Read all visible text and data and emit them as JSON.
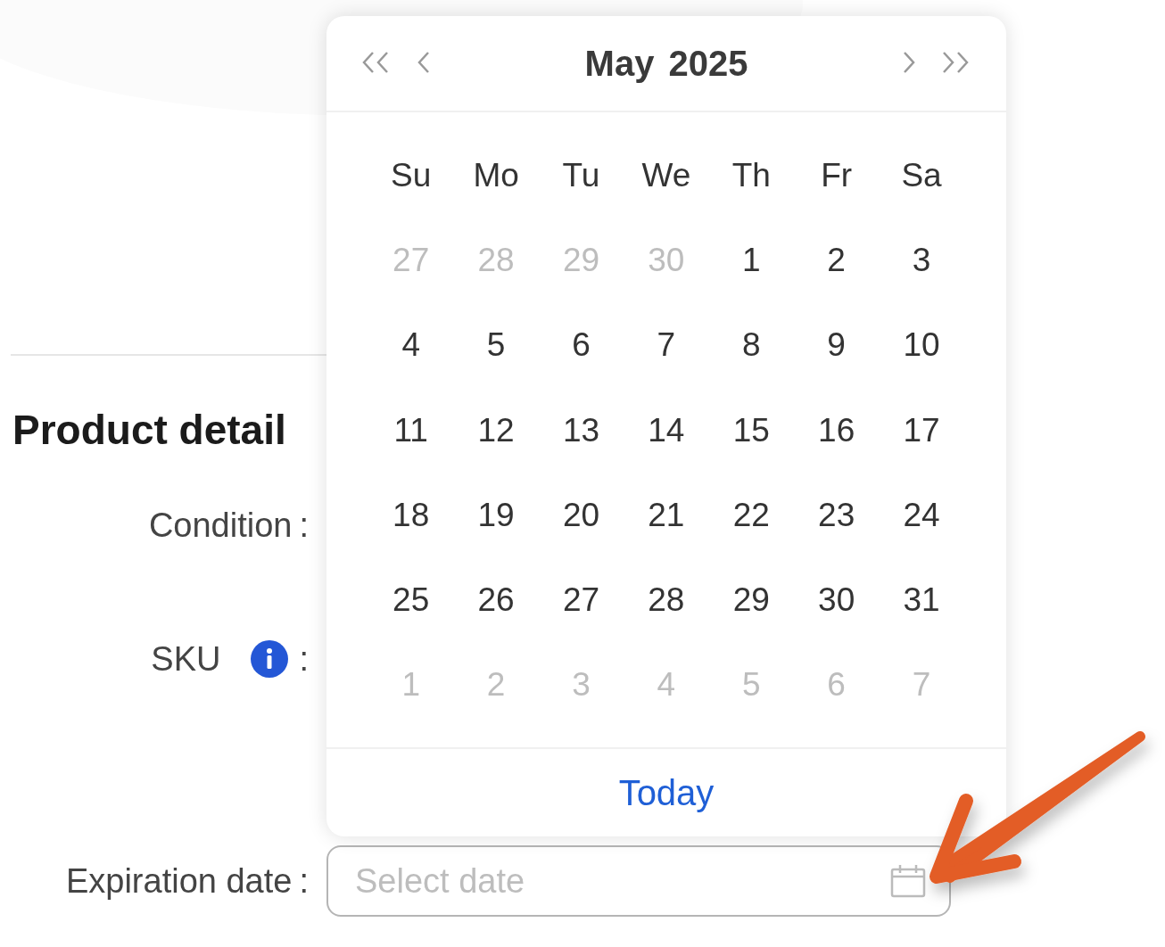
{
  "section": {
    "title": "Product detail"
  },
  "fields": [
    {
      "label": "Condition",
      "separator": ":",
      "info": false
    },
    {
      "label": "SKU",
      "separator": ":",
      "info": true
    },
    {
      "label": "Expiration date",
      "separator": ":",
      "info": false,
      "placeholder": "Select date"
    }
  ],
  "calendar": {
    "month": "May",
    "year": "2025",
    "weekdays": [
      "Su",
      "Mo",
      "Tu",
      "We",
      "Th",
      "Fr",
      "Sa"
    ],
    "weeks": [
      [
        {
          "day": "27",
          "outside": true
        },
        {
          "day": "28",
          "outside": true
        },
        {
          "day": "29",
          "outside": true
        },
        {
          "day": "30",
          "outside": true
        },
        {
          "day": "1",
          "outside": false
        },
        {
          "day": "2",
          "outside": false
        },
        {
          "day": "3",
          "outside": false
        }
      ],
      [
        {
          "day": "4",
          "outside": false
        },
        {
          "day": "5",
          "outside": false
        },
        {
          "day": "6",
          "outside": false
        },
        {
          "day": "7",
          "outside": false
        },
        {
          "day": "8",
          "outside": false
        },
        {
          "day": "9",
          "outside": false
        },
        {
          "day": "10",
          "outside": false
        }
      ],
      [
        {
          "day": "11",
          "outside": false
        },
        {
          "day": "12",
          "outside": false
        },
        {
          "day": "13",
          "outside": false
        },
        {
          "day": "14",
          "outside": false
        },
        {
          "day": "15",
          "outside": false
        },
        {
          "day": "16",
          "outside": false
        },
        {
          "day": "17",
          "outside": false
        }
      ],
      [
        {
          "day": "18",
          "outside": false
        },
        {
          "day": "19",
          "outside": false
        },
        {
          "day": "20",
          "outside": false
        },
        {
          "day": "21",
          "outside": false
        },
        {
          "day": "22",
          "outside": false
        },
        {
          "day": "23",
          "outside": false
        },
        {
          "day": "24",
          "outside": false
        }
      ],
      [
        {
          "day": "25",
          "outside": false
        },
        {
          "day": "26",
          "outside": false
        },
        {
          "day": "27",
          "outside": false
        },
        {
          "day": "28",
          "outside": false
        },
        {
          "day": "29",
          "outside": false
        },
        {
          "day": "30",
          "outside": false
        },
        {
          "day": "31",
          "outside": false
        }
      ],
      [
        {
          "day": "1",
          "outside": true
        },
        {
          "day": "2",
          "outside": true
        },
        {
          "day": "3",
          "outside": true
        },
        {
          "day": "4",
          "outside": true
        },
        {
          "day": "5",
          "outside": true
        },
        {
          "day": "6",
          "outside": true
        },
        {
          "day": "7",
          "outside": true
        }
      ]
    ],
    "today_link": "Today"
  }
}
